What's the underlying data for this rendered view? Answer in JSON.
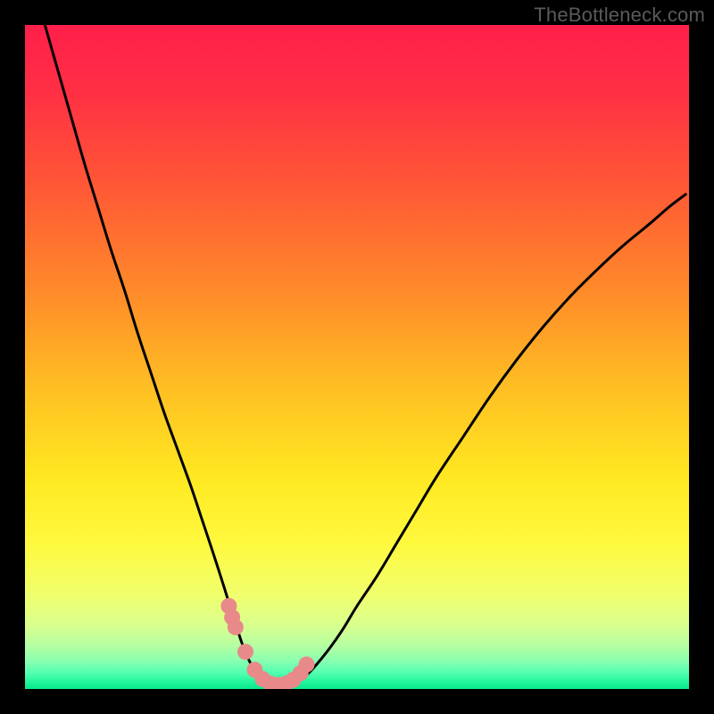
{
  "watermark": "TheBottleneck.com",
  "colors": {
    "frame": "#000000",
    "curve": "#000000",
    "marker_fill": "#e88a8a",
    "gradient_stops": [
      {
        "offset": 0.0,
        "color": "#ff1f4b"
      },
      {
        "offset": 0.1,
        "color": "#ff2f44"
      },
      {
        "offset": 0.25,
        "color": "#ff5a35"
      },
      {
        "offset": 0.4,
        "color": "#ff8a2a"
      },
      {
        "offset": 0.55,
        "color": "#ffc023"
      },
      {
        "offset": 0.68,
        "color": "#ffe821"
      },
      {
        "offset": 0.78,
        "color": "#fff93e"
      },
      {
        "offset": 0.86,
        "color": "#f0ff6e"
      },
      {
        "offset": 0.905,
        "color": "#d8ff8f"
      },
      {
        "offset": 0.935,
        "color": "#b5ffa2"
      },
      {
        "offset": 0.958,
        "color": "#88ffb0"
      },
      {
        "offset": 0.975,
        "color": "#55ffb0"
      },
      {
        "offset": 0.988,
        "color": "#26f79e"
      },
      {
        "offset": 1.0,
        "color": "#09e78a"
      }
    ]
  },
  "chart_data": {
    "type": "line",
    "title": "",
    "xlabel": "",
    "ylabel": "",
    "xlim": [
      0,
      100
    ],
    "ylim": [
      0,
      100
    ],
    "grid": false,
    "x": [
      3,
      5,
      7,
      9,
      11,
      13,
      15,
      17,
      19,
      21,
      23,
      25,
      26.5,
      28,
      29.3,
      30.4,
      31.3,
      32.2,
      33,
      33.8,
      34.6,
      35.4,
      36.2,
      37,
      38,
      39,
      40,
      41.2,
      42.5,
      44,
      46,
      48,
      50,
      53,
      56,
      59,
      62,
      66,
      70,
      74,
      78,
      82,
      86,
      90,
      94,
      97,
      99.5
    ],
    "y": [
      100,
      93,
      86,
      79,
      72.5,
      66,
      60,
      53.5,
      47.5,
      41.5,
      36,
      30.5,
      26,
      21.5,
      17.5,
      14,
      11,
      8.3,
      6,
      4.2,
      2.8,
      1.8,
      1.1,
      0.7,
      0.5,
      0.5,
      0.7,
      1.2,
      2.2,
      3.8,
      6.3,
      9.2,
      12.5,
      17,
      22,
      27,
      32,
      38,
      44,
      49.5,
      54.5,
      59,
      63,
      66.7,
      70,
      72.6,
      74.5
    ],
    "markers": {
      "x": [
        30.7,
        31.2,
        31.7,
        33.2,
        34.6,
        35.8,
        37.0,
        38.2,
        39.3,
        40.4,
        41.5,
        42.4
      ],
      "y": [
        12.5,
        10.8,
        9.3,
        5.6,
        2.9,
        1.5,
        0.8,
        0.6,
        0.8,
        1.4,
        2.4,
        3.7
      ]
    }
  }
}
